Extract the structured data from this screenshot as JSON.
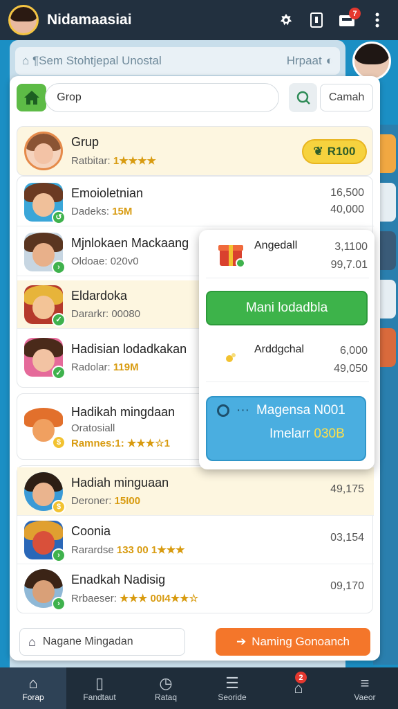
{
  "app": {
    "title": "Nidamaasiai",
    "notification_count": "7"
  },
  "background": {
    "search_text": "Sem Stohtjepal Unostal",
    "right_text": "Hrpaat"
  },
  "search": {
    "value": "Grop",
    "cancel_label": "Camah"
  },
  "list": [
    {
      "title": "Grup",
      "sub_prefix": "Ratbitar: ",
      "sub_value": "1★★★★",
      "badge": "R100",
      "highlight": true,
      "nums": []
    },
    {
      "title": "Emoioletnian",
      "sub_prefix": "Dadeks: ",
      "sub_value": "15M",
      "highlight": false,
      "nums": [
        "16,500",
        "40,000"
      ]
    },
    {
      "title": "Mjnlokaen Mackaang",
      "sub_prefix": "Oldoae: ",
      "sub_value": "020v0",
      "highlight": false,
      "nums": []
    },
    {
      "title": "Eldardoka",
      "sub_prefix": "Dararkr: ",
      "sub_value": "00080",
      "highlight": true,
      "nums": []
    },
    {
      "title": "Hadisian lodadkakan",
      "sub_prefix": "Radolar: ",
      "sub_value": "119M",
      "highlight": false,
      "nums": []
    },
    {
      "title": "Hadikah mingdaan",
      "sub_prefix": "Oratosiall",
      "sub_value": "Ramnes:1: ★★★☆1",
      "highlight": false,
      "nums": []
    },
    {
      "title": "Hadiah minguaan",
      "sub_prefix": "Deroner: ",
      "sub_value": "15I00",
      "highlight": true,
      "nums": [
        "49,175"
      ]
    },
    {
      "title": "Coonia",
      "sub_prefix": "Rarardse ",
      "sub_value": "133 00 1★★★",
      "highlight": false,
      "nums": [
        "03,154"
      ]
    },
    {
      "title": "Enadkah Nadisig",
      "sub_prefix": "Rrbaeser: ",
      "sub_value": "★★★ 00I4★★☆",
      "highlight": false,
      "nums": [
        "09,170"
      ]
    }
  ],
  "popup": {
    "item1": {
      "label": "Angedall",
      "nums": [
        "3,1100",
        "99,7.01"
      ]
    },
    "green_label": "Mani lodadbla",
    "item2": {
      "label": "Arddgchal",
      "nums": [
        "6,000",
        "49,050"
      ]
    },
    "blue": {
      "line1": "Magensa N001",
      "line2_prefix": "Imelarr ",
      "line2_value": "030B"
    }
  },
  "footer": {
    "field_label": "Nagane Mingadan",
    "button_label": "Naming Gonoanch"
  },
  "nav": [
    {
      "label": "Forap",
      "icon": "home-icon"
    },
    {
      "label": "Fandtaut",
      "icon": "bookmark-icon"
    },
    {
      "label": "Rataq",
      "icon": "clock-icon"
    },
    {
      "label": "Seoride",
      "icon": "list-icon"
    },
    {
      "label": "",
      "icon": "bell-icon",
      "badge": "2"
    },
    {
      "label": "Vaeor",
      "icon": "menu-icon"
    }
  ]
}
